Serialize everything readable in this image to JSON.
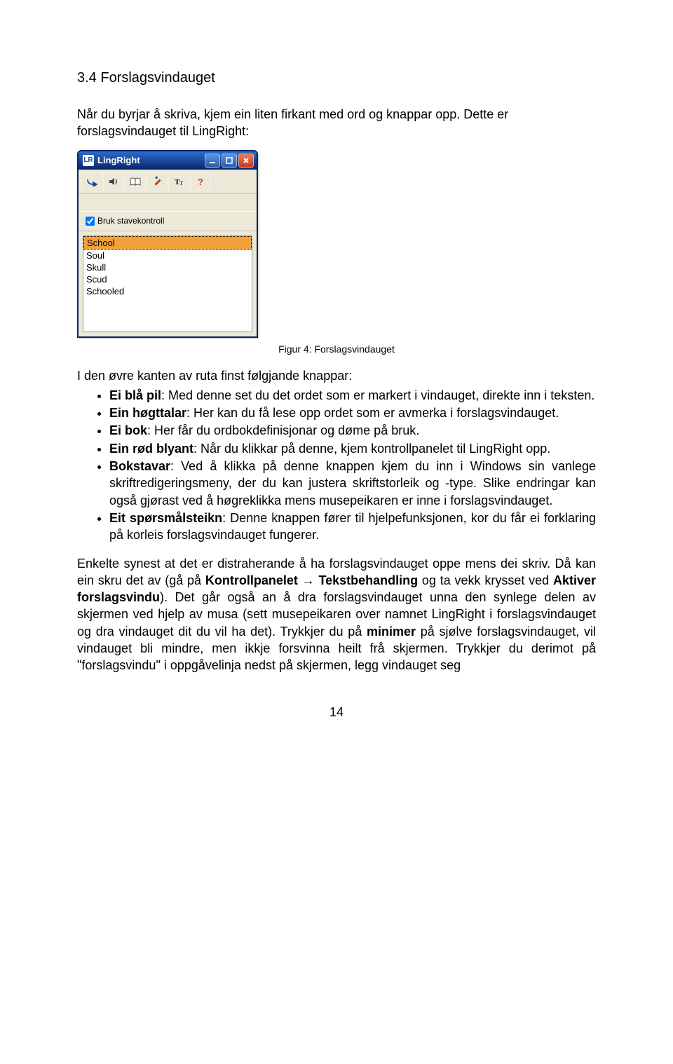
{
  "section": {
    "title": "3.4 Forslagsvindauget"
  },
  "intro": {
    "p1": "Når du byrjar å skriva, kjem ein liten firkant med ord og knappar opp. Dette er forslagsvindauget til LingRight:"
  },
  "figure": {
    "caption": "Figur 4: Forslagsvindauget",
    "window": {
      "app_icon_text": "LR",
      "title": "LingRight",
      "checkbox_label": "Bruk stavekontroll",
      "checkbox_checked": true,
      "suggestions": [
        "School",
        "Soul",
        "Skull",
        "Scud",
        "Schooled"
      ],
      "selected_index": 0
    }
  },
  "lead": "I den øvre kanten av ruta finst følgjande knappar:",
  "bullets": [
    {
      "term": "Ei blå pil",
      "text": ": Med denne set du det ordet som er markert i vindauget, direkte inn i teksten."
    },
    {
      "term": "Ein høgttalar",
      "text": ": Her kan du få lese opp ordet som er avmerka i forslagsvindauget."
    },
    {
      "term": "Ei bok",
      "text": ": Her får du ordbokdefinisjonar og døme på bruk."
    },
    {
      "term": "Ein rød blyant",
      "text": ": Når du klikkar på denne, kjem kontrollpanelet til LingRight opp."
    },
    {
      "term": "Bokstavar",
      "text": ": Ved å klikka på denne knappen kjem du inn i Windows sin vanlege skriftredigeringsmeny, der du kan justera skriftstorleik og -type. Slike endringar kan også gjørast ved å høgreklikka mens musepeikaren er inne i forslagsvindauget."
    },
    {
      "term": "Eit spørsmålsteikn",
      "text": ": Denne knappen fører til hjelpefunksjonen, kor du får ei forklaring på korleis forslagsvindauget fungerer."
    }
  ],
  "post": {
    "pre1": "Enkelte synest at det er distraherande å ha forslagsvindauget oppe mens dei skriv. Då kan ein skru det av (gå på ",
    "b1": "Kontrollpanelet",
    "arrow": " → ",
    "b2": "Tekstbehandling",
    "mid1": " og ta vekk krysset ved ",
    "b3": "Aktiver forslagsvindu",
    "mid2": "). Det går også an å dra forslagsvindauget unna den synlege delen av skjermen ved hjelp av musa (sett musepeikaren over namnet LingRight i forslagsvindauget og dra vindauget dit du vil ha det). Trykkjer du på ",
    "b4": "minimer",
    "mid3": " på sjølve forslagsvindauget, vil vindauget bli mindre, men ikkje forsvinna heilt frå skjermen. Trykkjer du derimot på ",
    "q1": "\"forslagsvindu\"",
    "tail": " i oppgåvelinja nedst på skjermen, legg vindauget seg"
  },
  "page_number": "14"
}
